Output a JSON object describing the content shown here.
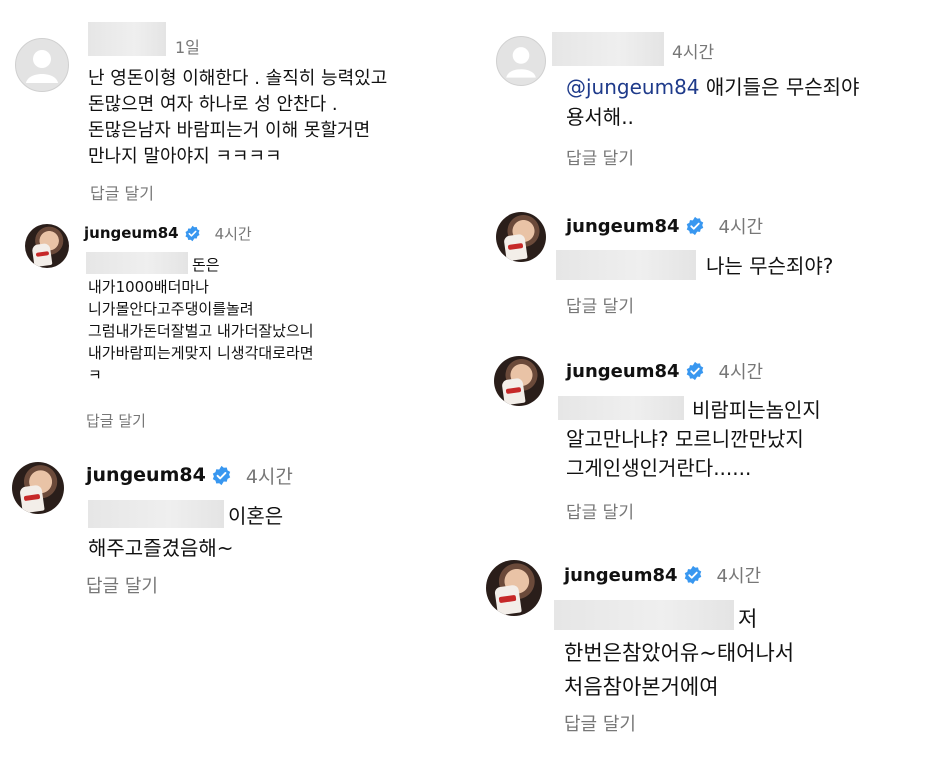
{
  "comments": [
    {
      "time": "1일",
      "text": "난 영돈이형 이해한다 . 솔직히 능력있고\n돈많으면 여자 하나로 성 안찬다 .\n돈많은남자 바람피는거 이해 못할거면\n만나지 말아야지 ㅋㅋㅋㅋ",
      "reply": "답글 달기"
    },
    {
      "username": "jungeum84",
      "time": "4시간",
      "text": "돈은\n내가1000배더마나\n니가몰안다고주댕이를놀려\n그럼내가돈더잘벌고 내가더잘났으니\n내가바람피는게맞지 니생각대로라면\nㅋ",
      "reply": "답글 달기"
    },
    {
      "username": "jungeum84",
      "time": "4시간",
      "text": "이혼은\n해주고즐겼음해~",
      "reply": "답글 달기"
    },
    {
      "time": "4시간",
      "mention": "@jungeum84",
      "text": "애기들은 무슨죄야\n용서해..",
      "reply": "답글 달기"
    },
    {
      "username": "jungeum84",
      "time": "4시간",
      "text": "나는 무슨죄야?",
      "reply": "답글 달기"
    },
    {
      "username": "jungeum84",
      "time": "4시간",
      "text": "비람피는놈인지\n알고만나냐? 모르니깐만났지\n그게인생인거란다......",
      "reply": "답글 달기"
    },
    {
      "username": "jungeum84",
      "time": "4시간",
      "text": "저\n한번은참았어유~태어나서\n처음참아본거에여",
      "reply": "답글 달기"
    }
  ]
}
